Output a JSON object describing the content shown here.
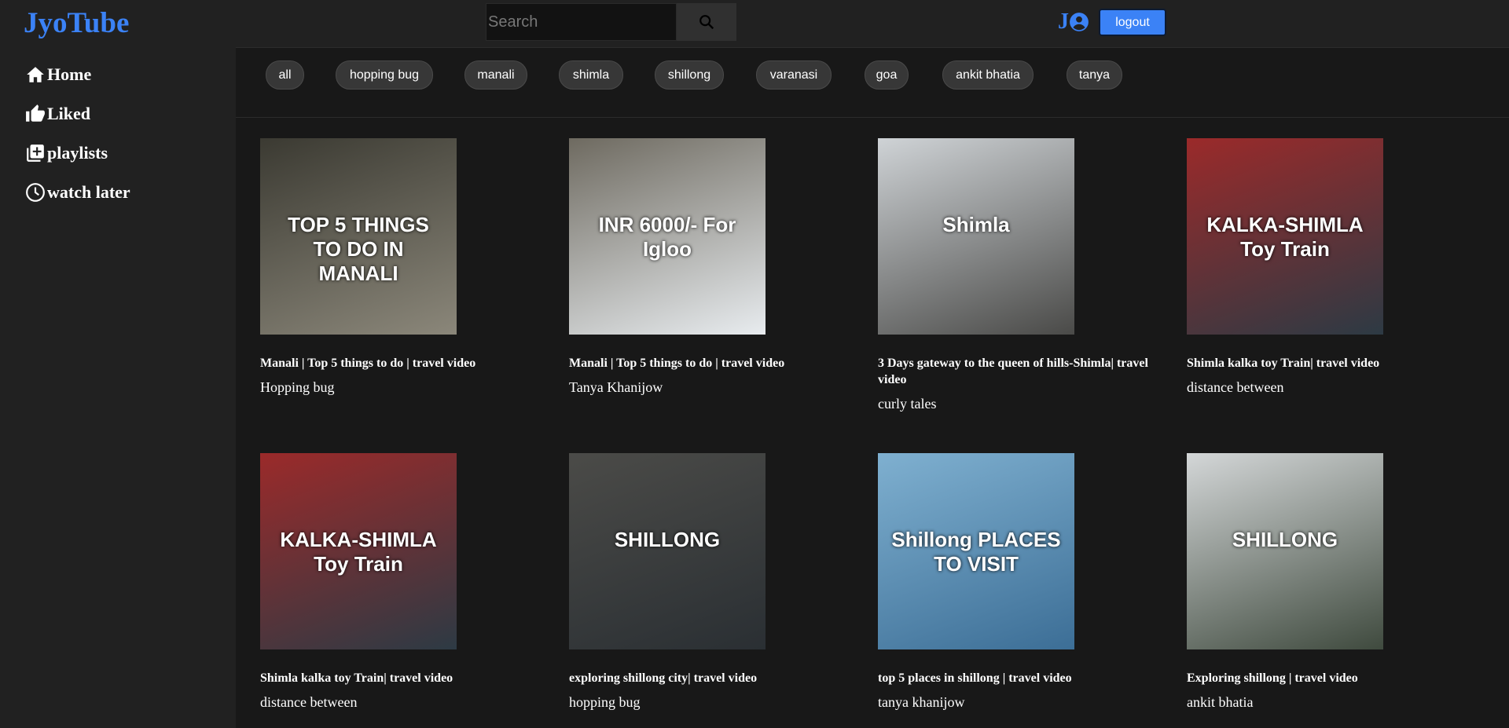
{
  "header": {
    "logo": "JyoTube",
    "search_placeholder": "Search",
    "user_initial": "J",
    "logout_label": "logout"
  },
  "sidebar": {
    "items": [
      {
        "label": "Home",
        "icon": "home-icon"
      },
      {
        "label": "Liked",
        "icon": "thumbs-up-icon"
      },
      {
        "label": "playlists",
        "icon": "playlist-add-icon"
      },
      {
        "label": "watch later",
        "icon": "clock-icon"
      }
    ]
  },
  "chips": [
    "all",
    "hopping bug",
    "manali",
    "shimla",
    "shillong",
    "varanasi",
    "goa",
    "ankit bhatia",
    "tanya"
  ],
  "videos": [
    {
      "title": "Manali | Top 5 things to do | travel video",
      "channel": "Hopping bug",
      "thumb": [
        "#3b3a32",
        "#8b877a"
      ],
      "overlay": "TOP 5 THINGS TO DO IN MANALI"
    },
    {
      "title": "Manali | Top 5 things to do | travel video",
      "channel": "Tanya Khanijow",
      "thumb": [
        "#6e6a60",
        "#e8ecef"
      ],
      "overlay": "INR 6000/- For Igloo"
    },
    {
      "title": "3 Days gateway to the queen of hills-Shimla| travel video",
      "channel": "curly tales",
      "thumb": [
        "#cfd3d6",
        "#4a4a48"
      ],
      "overlay": "Shimla"
    },
    {
      "title": "Shimla kalka toy Train| travel video",
      "channel": "distance between",
      "thumb": [
        "#9b2a2a",
        "#2d3a44"
      ],
      "overlay": "KALKA-SHIMLA Toy Train"
    },
    {
      "title": "Shimla kalka toy Train| travel video",
      "channel": "distance between",
      "thumb": [
        "#9b2a2a",
        "#2d3a44"
      ],
      "overlay": "KALKA-SHIMLA Toy Train"
    },
    {
      "title": "exploring shillong city| travel video",
      "channel": "hopping bug",
      "thumb": [
        "#4b4b48",
        "#2a2f33"
      ],
      "overlay": "SHILLONG"
    },
    {
      "title": "top 5 places in shillong | travel video",
      "channel": "tanya khanijow",
      "thumb": [
        "#7fb0d0",
        "#3c6e96"
      ],
      "overlay": "Shillong PLACES TO VISIT"
    },
    {
      "title": "Exploring shillong | travel video",
      "channel": "ankit bhatia",
      "thumb": [
        "#d4d7d8",
        "#3f4a3e"
      ],
      "overlay": "SHILLONG"
    }
  ]
}
